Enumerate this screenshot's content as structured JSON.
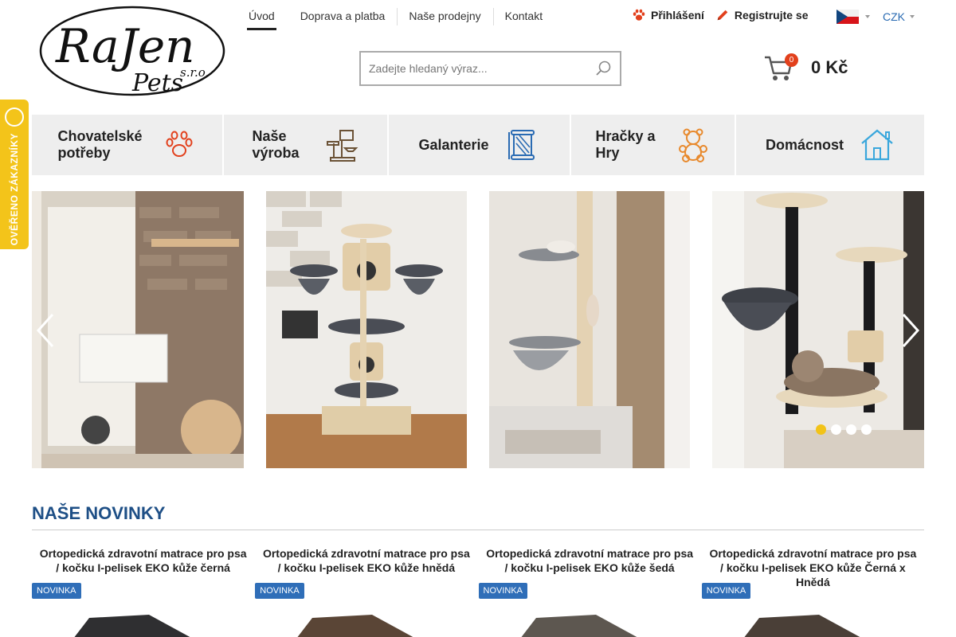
{
  "brand": {
    "logo_text": "RaJen Pets s.r.o."
  },
  "topnav": [
    "Úvod",
    "Doprava a platba",
    "Naše prodejny",
    "Kontakt"
  ],
  "user": {
    "login": "Přihlášení",
    "register": "Registrujte se"
  },
  "lang": {
    "currency": "CZK"
  },
  "search": {
    "placeholder": "Zadejte hledaný výraz..."
  },
  "cart": {
    "count": "0",
    "total": "0 Kč"
  },
  "categories": [
    {
      "label": "Chovatelské potřeby",
      "icon": "paw-icon"
    },
    {
      "label": "Naše výroba",
      "icon": "cat-tree-icon"
    },
    {
      "label": "Galanterie",
      "icon": "thread-spool-icon"
    },
    {
      "label": "Hračky a Hry",
      "icon": "teddy-bear-icon"
    },
    {
      "label": "Domácnost",
      "icon": "house-icon"
    }
  ],
  "side_badge": {
    "text": "OVĚŘENO ZÁKAZNÍKY"
  },
  "slider": {
    "slide_count": 4,
    "active_slide": 1
  },
  "section": {
    "title": "NAŠE NOVINKY"
  },
  "products": [
    {
      "title": "Ortopedická zdravotní matrace pro psa / kočku I-pelisek EKO kůže černá",
      "badge": "NOVINKA"
    },
    {
      "title": "Ortopedická zdravotní matrace pro psa / kočku I-pelisek EKO kůže hnědá",
      "badge": "NOVINKA"
    },
    {
      "title": "Ortopedická zdravotní matrace pro psa / kočku I-pelisek EKO kůže šedá",
      "badge": "NOVINKA"
    },
    {
      "title": "Ortopedická zdravotní matrace pro psa / kočku I-pelisek EKO kůže Černá x Hnědá",
      "badge": "NOVINKA"
    }
  ],
  "colors": {
    "accent_blue": "#1e4f86",
    "badge_yellow": "#f3c41a",
    "cart_badge": "#e2401c",
    "category_bg": "#eeeeee"
  }
}
